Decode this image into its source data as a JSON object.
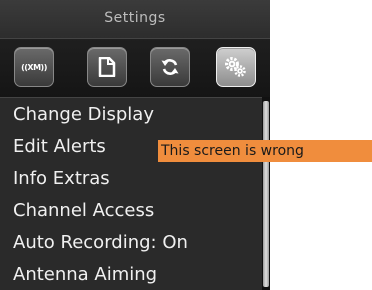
{
  "header": {
    "title": "Settings"
  },
  "tabs": [
    {
      "icon": "xm-radio-icon",
      "label": "((XM))"
    },
    {
      "icon": "document-icon"
    },
    {
      "icon": "refresh-icon"
    },
    {
      "icon": "gears-icon",
      "selected": true
    }
  ],
  "menu": {
    "items": [
      "Change Display",
      "Edit Alerts",
      "Info Extras",
      "Channel Access",
      "Auto Recording: On",
      "Antenna Aiming"
    ]
  },
  "annotation": {
    "text": "This screen is wrong",
    "color": "#f08d3d"
  },
  "colors": {
    "background": "#2a2a2a",
    "text": "#f0f0f0",
    "title_text": "#bdbdbd"
  }
}
